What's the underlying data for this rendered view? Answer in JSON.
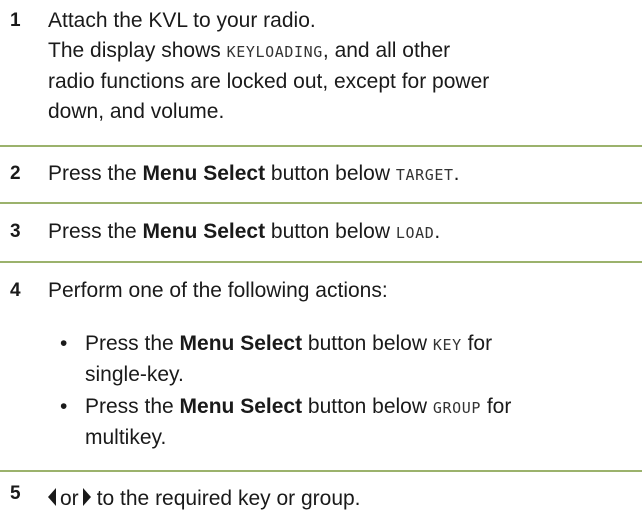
{
  "step1": {
    "number": "1",
    "line1": "Attach the KVL to your radio.",
    "line2_pre": "The display shows ",
    "line2_display": "KEYLOADING",
    "line2_post": ", and all other",
    "line3": "radio functions are locked out, except for power",
    "line4": "down, and volume."
  },
  "step2": {
    "number": "2",
    "pre": "Press the ",
    "bold": "Menu Select",
    "mid": " button below ",
    "display": "TARGET",
    "post": "."
  },
  "step3": {
    "number": "3",
    "pre": "Press the ",
    "bold": "Menu Select",
    "mid": " button below ",
    "display": "LOAD",
    "post": "."
  },
  "step4": {
    "number": "4",
    "intro": "Perform one of the following actions:",
    "bullet_symbol": "•",
    "bullets": [
      {
        "pre": "Press the ",
        "bold": "Menu Select",
        "mid": " button below ",
        "display": "KEY",
        "post": " for",
        "cont": "single-key."
      },
      {
        "pre": "Press the ",
        "bold": "Menu Select",
        "mid": " button below ",
        "display": "GROUP",
        "post": " for",
        "cont": "multikey."
      }
    ]
  },
  "step5": {
    "number": "5",
    "left_icon": "left-arrow-icon",
    "or_text": "or",
    "right_icon": "right-arrow-icon",
    "rest": "to the required key or group."
  },
  "colors": {
    "rule": "#9bb26c",
    "text": "#1a1a1a"
  }
}
